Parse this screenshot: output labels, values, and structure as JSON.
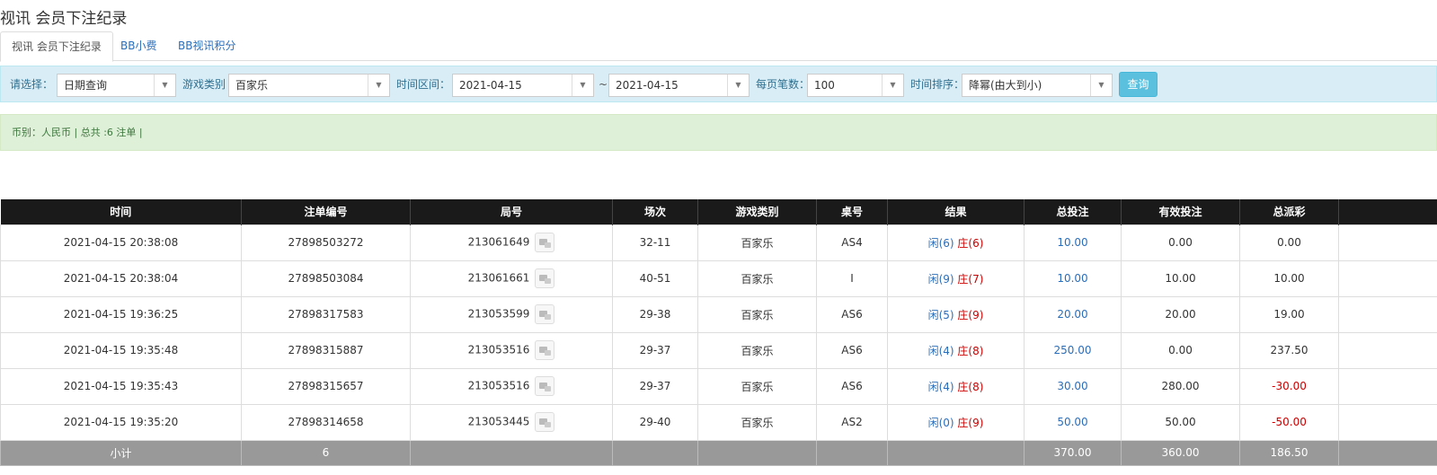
{
  "page_title": "视讯 会员下注纪录",
  "tabs": [
    {
      "label": "视讯 会员下注纪录"
    },
    {
      "label": "BB小费"
    },
    {
      "label": "BB视讯积分"
    }
  ],
  "filters": {
    "select_label": "请选择：",
    "select_value": "日期查询",
    "game_type_label": "游戏类别",
    "game_type_value": "百家乐",
    "time_range_label": "时间区间：",
    "date_from": "2021-04-15",
    "tilde": "~",
    "date_to": "2021-04-15",
    "per_page_label": "每页笔数：",
    "per_page_value": "100",
    "sort_label": "时间排序：",
    "sort_value": "降幂(由大到小)",
    "query_button": "查询"
  },
  "summary_text": "币别：人民币 | 总共 :6 注单 |",
  "table": {
    "columns": [
      "时间",
      "注单编号",
      "局号",
      "场次",
      "游戏类别",
      "桌号",
      "结果",
      "总投注",
      "有效投注",
      "总派彩",
      ""
    ],
    "rows": [
      {
        "time": "2021-04-15 20:38:08",
        "bet_no": "27898503272",
        "round": "213061649",
        "session": "32-11",
        "game": "百家乐",
        "table": "AS4",
        "player": "闲(6)",
        "banker": "庄(6)",
        "total_bet": "10.00",
        "valid_bet": "0.00",
        "payout": "0.00",
        "payout_negative": false
      },
      {
        "time": "2021-04-15 20:38:04",
        "bet_no": "27898503084",
        "round": "213061661",
        "session": "40-51",
        "game": "百家乐",
        "table": "I",
        "player": "闲(9)",
        "banker": "庄(7)",
        "total_bet": "10.00",
        "valid_bet": "10.00",
        "payout": "10.00",
        "payout_negative": false
      },
      {
        "time": "2021-04-15 19:36:25",
        "bet_no": "27898317583",
        "round": "213053599",
        "session": "29-38",
        "game": "百家乐",
        "table": "AS6",
        "player": "闲(5)",
        "banker": "庄(9)",
        "total_bet": "20.00",
        "valid_bet": "20.00",
        "payout": "19.00",
        "payout_negative": false
      },
      {
        "time": "2021-04-15 19:35:48",
        "bet_no": "27898315887",
        "round": "213053516",
        "session": "29-37",
        "game": "百家乐",
        "table": "AS6",
        "player": "闲(4)",
        "banker": "庄(8)",
        "total_bet": "250.00",
        "valid_bet": "0.00",
        "payout": "237.50",
        "payout_negative": false
      },
      {
        "time": "2021-04-15 19:35:43",
        "bet_no": "27898315657",
        "round": "213053516",
        "session": "29-37",
        "game": "百家乐",
        "table": "AS6",
        "player": "闲(4)",
        "banker": "庄(8)",
        "total_bet": "30.00",
        "valid_bet": "280.00",
        "payout": "-30.00",
        "payout_negative": true
      },
      {
        "time": "2021-04-15 19:35:20",
        "bet_no": "27898314658",
        "round": "213053445",
        "session": "29-40",
        "game": "百家乐",
        "table": "AS2",
        "player": "闲(0)",
        "banker": "庄(9)",
        "total_bet": "50.00",
        "valid_bet": "50.00",
        "payout": "-50.00",
        "payout_negative": true
      }
    ],
    "total": {
      "label": "小计",
      "count": "6",
      "total_bet": "370.00",
      "valid_bet": "360.00",
      "payout": "186.50"
    }
  },
  "colors": {
    "bet_link": "#2a6ebb",
    "negative": "#cc0000",
    "filter_bg": "#d9edf7",
    "summary_bg": "#dff0d8",
    "header_bg": "#1a1a1a",
    "query_button": "#5bc0de"
  }
}
